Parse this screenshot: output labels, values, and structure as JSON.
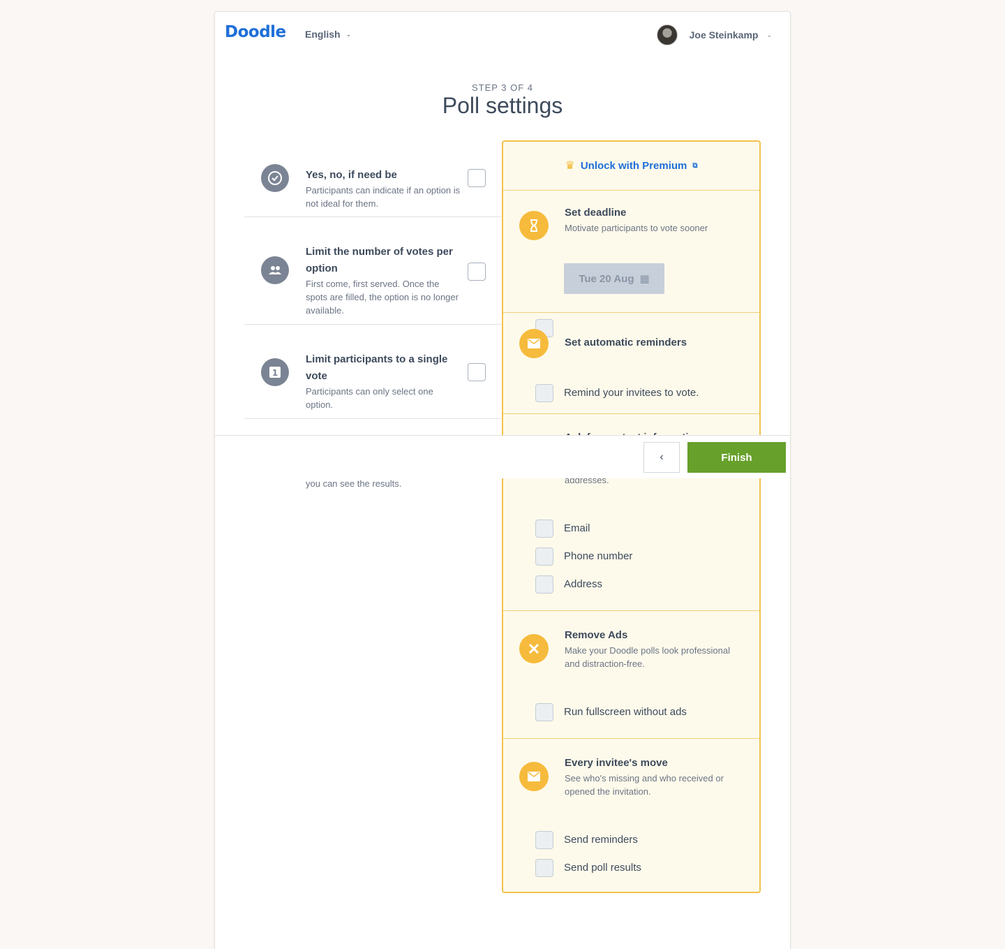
{
  "header": {
    "logo": "Doodle",
    "language": "English",
    "user_name": "Joe Steinkamp"
  },
  "page": {
    "step": "STEP 3 OF 4",
    "title": "Poll settings"
  },
  "settings": [
    {
      "title": "Yes, no, if need be",
      "description": "Participants can indicate if an option is not ideal for them.",
      "icon": "check-circle-icon"
    },
    {
      "title": "Limit the number of votes per option",
      "description": "First come, first served. Once the spots are filled, the option is no longer available.",
      "icon": "people-icon"
    },
    {
      "title": "Limit participants to a single vote",
      "description": "Participants can only select one option.",
      "icon": "number-one-icon"
    }
  ],
  "hidden_setting_tail": "you can see the results.",
  "premium": {
    "unlock_label": "Unlock with Premium",
    "deadline": {
      "title": "Set deadline",
      "description": "Motivate participants to vote sooner",
      "date": "Tue 20 Aug"
    },
    "reminders": {
      "title": "Set automatic reminders",
      "option": "Remind your invitees to vote."
    },
    "contact": {
      "title": "Ask for contact information",
      "description_tail": "addresses.",
      "options": [
        "Email",
        "Phone number",
        "Address"
      ]
    },
    "ads": {
      "title": "Remove Ads",
      "description": "Make your Doodle polls look professional and distraction-free.",
      "option": "Run fullscreen without ads"
    },
    "invitee": {
      "title": "Every invitee's move",
      "description": "See who's missing and who received or opened the invitation.",
      "options": [
        "Send reminders",
        "Send poll results"
      ]
    }
  },
  "footer": {
    "back_label": "‹",
    "finish_label": "Finish"
  },
  "colors": {
    "brand": "#1e6fd9",
    "premium_accent": "#f6bb3c",
    "finish": "#67a02b"
  }
}
